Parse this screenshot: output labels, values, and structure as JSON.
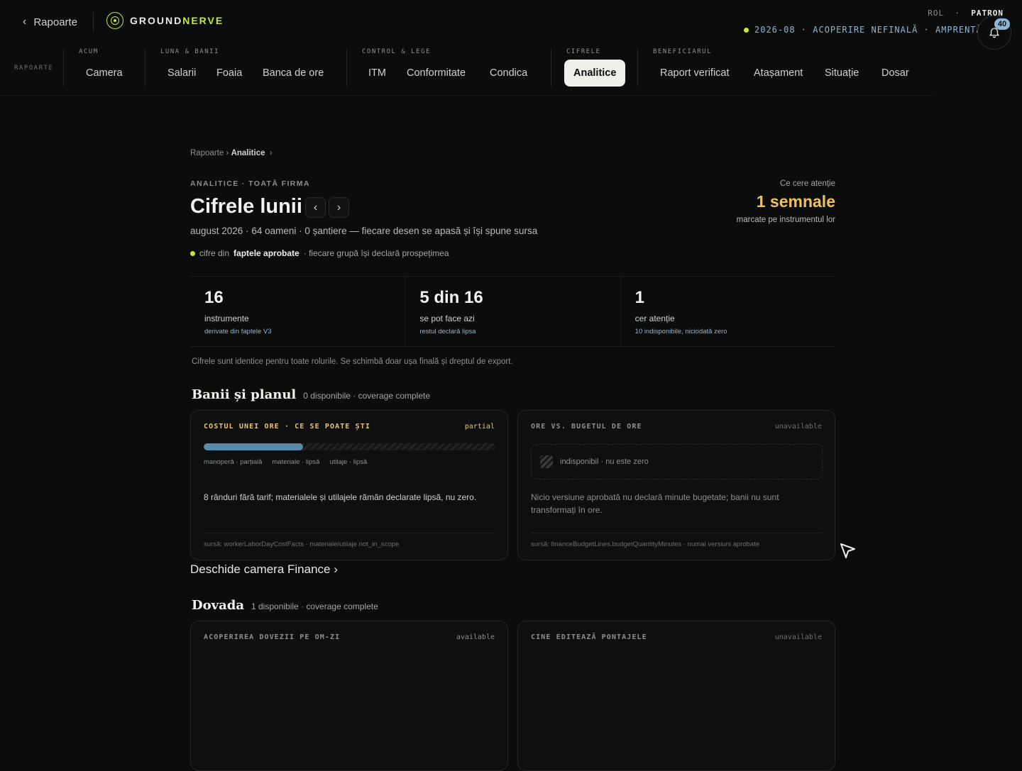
{
  "header": {
    "back_label": "Rapoarte",
    "logo_part_a": "GROUND",
    "logo_part_b": "NERVE",
    "role_label": "ROL",
    "role_sep": "·",
    "role_value": "PATRON",
    "status_text": "2026-08 · ACOPERIRE NEFINALĂ · AMPRENTĂ",
    "notification_count": "40"
  },
  "nav": {
    "section_label": "RAPOARTE",
    "groups": [
      {
        "label": "ACUM",
        "tabs": [
          "Camera"
        ]
      },
      {
        "label": "LUNA & BANII",
        "tabs": [
          "Salarii",
          "Foaia",
          "Banca de ore"
        ]
      },
      {
        "label": "CONTROL & LEGE",
        "tabs": [
          "ITM",
          "Conformitate",
          "Condica"
        ]
      },
      {
        "label": "CIFRELE",
        "tabs": [
          "Analitice"
        ]
      },
      {
        "label": "BENEFICIARUL",
        "tabs": [
          "Raport verificat",
          "Atașament",
          "Situație",
          "Dosar"
        ]
      }
    ],
    "active_tab": "Analitice"
  },
  "breadcrumb": {
    "root": "Rapoarte",
    "sep": "›",
    "current": "Analitice",
    "trail": "›"
  },
  "page": {
    "eyebrow": "ANALITICE · TOATĂ FIRMA",
    "title": "Cifrele lunii",
    "prev": "‹",
    "next": "›",
    "subtitle": "august 2026 · 64 oameni · 0 șantiere — fiecare desen se apasă și își spune sursa",
    "facts_pre": "cifre din",
    "facts_bold": "faptele aprobate",
    "facts_post": "· fiecare grupă își declară prospețimea"
  },
  "attention": {
    "label": "Ce cere atenție",
    "value": "1 semnale",
    "sub": "marcate pe instrumentul lor"
  },
  "stats": [
    {
      "number": "16",
      "label": "instrumente",
      "detail": "derivate din faptele V3"
    },
    {
      "number": "5 din 16",
      "label": "se pot face azi",
      "detail": "restul declară lipsa"
    },
    {
      "number": "1",
      "label": "cer atenție",
      "detail": "10 indisponibile, niciodată zero"
    }
  ],
  "note": "Cifrele sunt identice pentru toate rolurile. Se schimbă doar ușa finală și dreptul de export.",
  "sections": {
    "bani": {
      "title": "Banii și planul",
      "meta": "0 disponibile · coverage complete"
    },
    "dovada": {
      "title": "Dovada",
      "meta": "1 disponibile · coverage complete"
    }
  },
  "cards": {
    "cost": {
      "title": "COSTUL UNEI ORE · CE SE POATE ȘTI",
      "status": "partial",
      "progress_fraction": 0.34,
      "legend": [
        "manoperă · parțială",
        "materiale · lipsă",
        "utilaje · lipsă"
      ],
      "body": "8 rânduri fără tarif; materialele și utilajele rămân declarate lipsă, nu zero.",
      "source": "sursă: workerLaborDayCostFacts · materiale/utilaje not_in_scope"
    },
    "ore": {
      "title": "ORE VS. BUGETUL DE ORE",
      "status": "unavailable",
      "placeholder": "indisponibil · nu este zero",
      "body": "Nicio versiune aprobată nu declară minute bugetate; banii nu sunt transformați în ore.",
      "source": "sursă: financeBudgetLines.budgetQuantityMinutes · numai versiuni aprobate"
    },
    "dovezi": {
      "title": "ACOPERIREA DOVEZII PE OM-ZI",
      "status": "available"
    },
    "pontaje": {
      "title": "CINE EDITEAZĂ PONTAJELE",
      "status": "unavailable"
    }
  },
  "links": {
    "finance": "Deschide camera Finance ›"
  },
  "colors": {
    "accent": "#c8e63c",
    "info": "#8bb6d6",
    "warn": "#f0c25a",
    "bg": "#0b0c0c"
  }
}
